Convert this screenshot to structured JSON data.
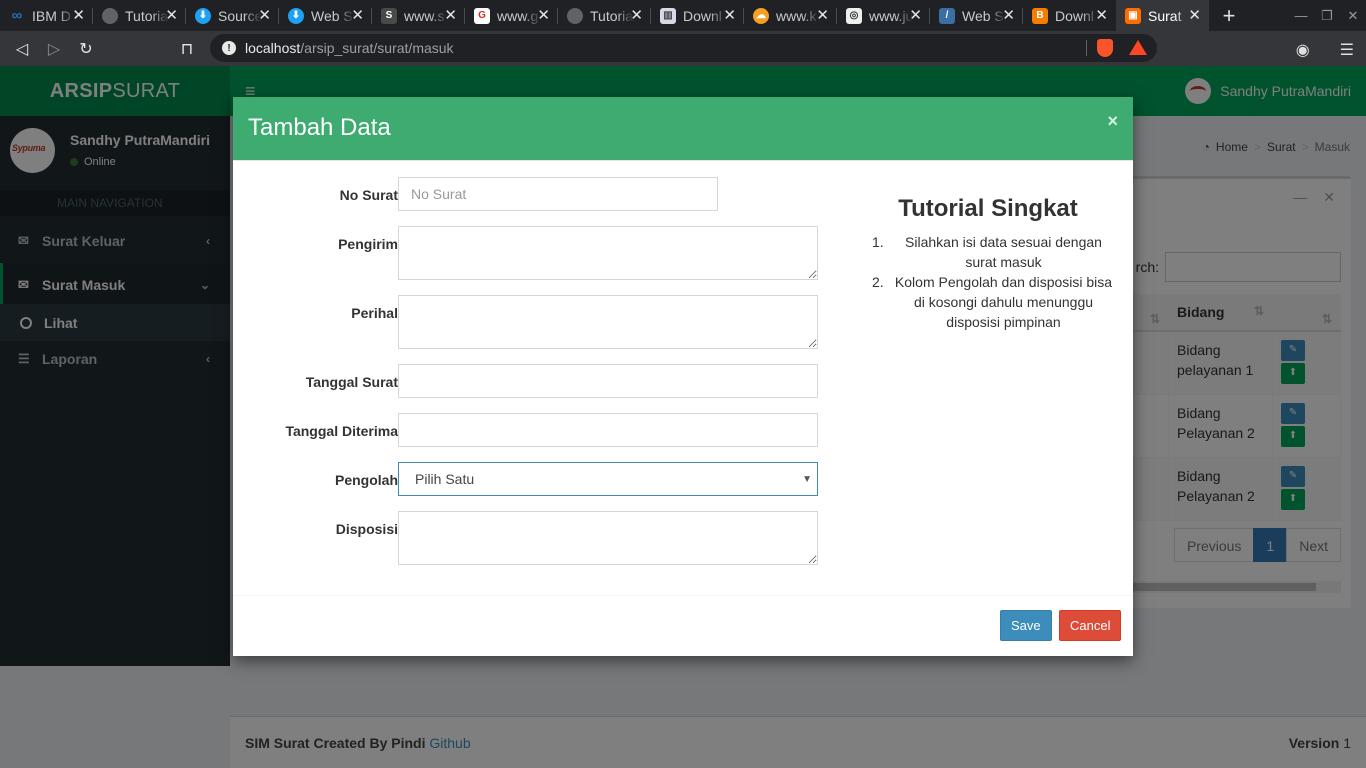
{
  "browser": {
    "tabs": [
      {
        "label": "IBM D",
        "icon": "infinity-icon",
        "color": "#1f70c1"
      },
      {
        "label": "Tutoria",
        "icon": "globe-icon",
        "color": "#5f6368"
      },
      {
        "label": "Source",
        "icon": "download-icon",
        "color": "#1da1f2"
      },
      {
        "label": "Web S",
        "icon": "download-icon",
        "color": "#1da1f2"
      },
      {
        "label": "www.s",
        "icon": "s-icon",
        "color": "#4a4a4a"
      },
      {
        "label": "www.g",
        "icon": "g-icon",
        "color": "#d93025"
      },
      {
        "label": "Tutoria",
        "icon": "globe-icon",
        "color": "#5f6368"
      },
      {
        "label": "Downl",
        "icon": "book-icon",
        "color": "#7a7a9a"
      },
      {
        "label": "www.k",
        "icon": "cloud-icon",
        "color": "#f4a020"
      },
      {
        "label": "www.ju",
        "icon": "circle-icon",
        "color": "#6a6a6a"
      },
      {
        "label": "Web S",
        "icon": "code-icon",
        "color": "#3a6ea5"
      },
      {
        "label": "Downl",
        "icon": "blogger-icon",
        "color": "#f57d00"
      },
      {
        "label": "Surat",
        "icon": "app-icon",
        "color": "#ff6d00"
      }
    ],
    "url_host": "localhost",
    "url_path": "/arsip_surat/surat/masuk"
  },
  "header": {
    "logo_bold": "ARSIP",
    "logo_rest": "SURAT",
    "user_name": "Sandhy PutraMandiri"
  },
  "sidebar": {
    "user_name": "Sandhy PutraMandiri",
    "status": "Online",
    "avatar_text": "Sypuma",
    "nav_header": "MAIN NAVIGATION",
    "items": [
      {
        "label": "Surat Keluar"
      },
      {
        "label": "Surat Masuk"
      },
      {
        "label": "Lihat"
      },
      {
        "label": "Laporan"
      }
    ]
  },
  "breadcrumb": {
    "home": "Home",
    "surat": "Surat",
    "masuk": "Masuk"
  },
  "table": {
    "search_label": "rch:",
    "headers": [
      "Bidang",
      ""
    ],
    "rows": [
      {
        "bidang_1": "Bidang",
        "bidang_2": "pelayanan 1"
      },
      {
        "bidang_1": "Bidang",
        "bidang_2": "Pelayanan 2"
      },
      {
        "bidang_1": "Bidang",
        "bidang_2": "Pelayanan 2"
      }
    ],
    "pagination": {
      "previous": "Previous",
      "current": "1",
      "next": "Next"
    }
  },
  "footer": {
    "credit": "SIM Surat Created By Pindi",
    "link": "Github",
    "version_label": "Version",
    "version": "1"
  },
  "modal": {
    "title": "Tambah Data",
    "close": "×",
    "form": {
      "no_surat": {
        "label": "No Surat",
        "placeholder": "No Surat",
        "value": ""
      },
      "pengirim": {
        "label": "Pengirim",
        "value": ""
      },
      "perihal": {
        "label": "Perihal",
        "value": ""
      },
      "tanggal_surat": {
        "label": "Tanggal Surat",
        "value": ""
      },
      "tanggal_diterima": {
        "label": "Tanggal Diterima",
        "value": ""
      },
      "pengolah": {
        "label": "Pengolah",
        "selected": "Pilih Satu"
      },
      "disposisi": {
        "label": "Disposisi",
        "value": ""
      }
    },
    "tutorial": {
      "title": "Tutorial Singkat",
      "items": [
        {
          "num": "1.",
          "text": "Silahkan isi data sesuai dengan surat masuk"
        },
        {
          "num": "2.",
          "text": "Kolom Pengolah dan disposisi bisa di kosongi dahulu menunggu disposisi pimpinan"
        }
      ]
    },
    "buttons": {
      "save": "Save",
      "cancel": "Cancel"
    }
  }
}
